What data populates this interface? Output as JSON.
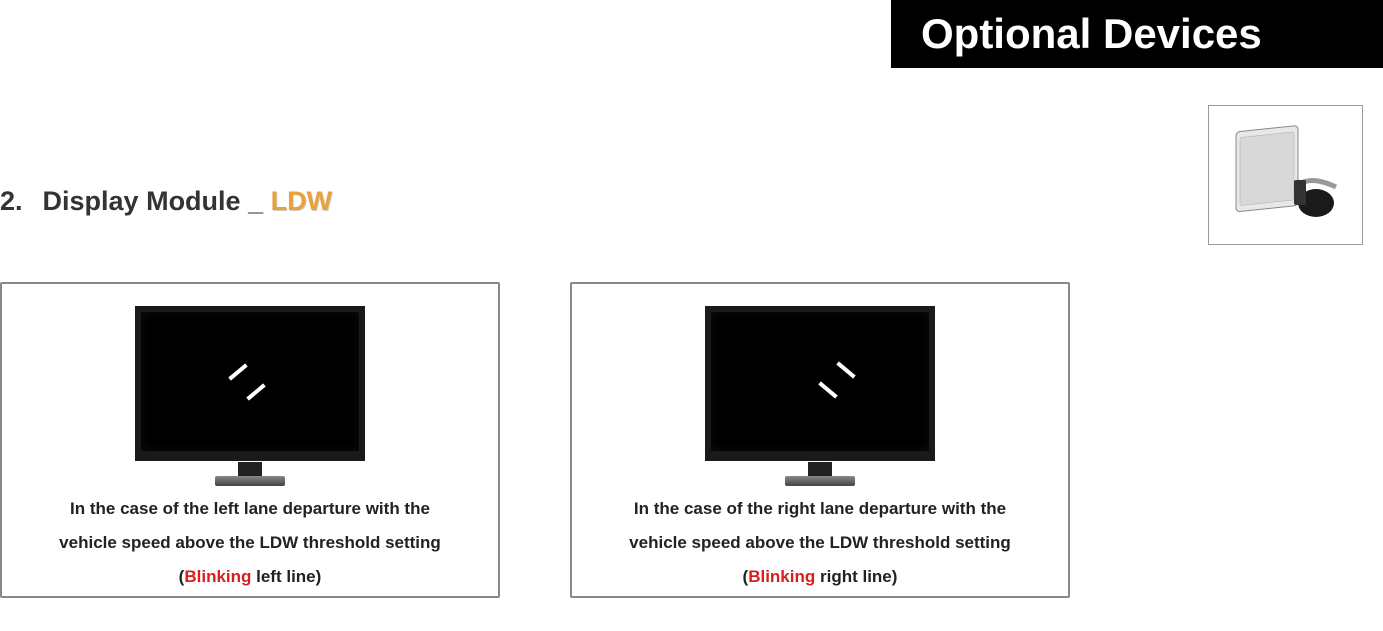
{
  "header": {
    "banner": "Optional Devices"
  },
  "section": {
    "number": "2.",
    "title_prefix": "Display Module _ ",
    "title_highlight": "LDW"
  },
  "panels": {
    "left": {
      "line1": "In the case of the left lane departure with the",
      "line2": "vehicle speed above the LDW threshold setting",
      "paren_open": "(",
      "blinking": "Blinking",
      "after_blinking": " left line)"
    },
    "right": {
      "line1": "In the case of the right lane departure with the",
      "line2": "vehicle speed above the LDW threshold setting",
      "paren_open": "(",
      "blinking": "Blinking",
      "after_blinking": " right line)"
    }
  }
}
